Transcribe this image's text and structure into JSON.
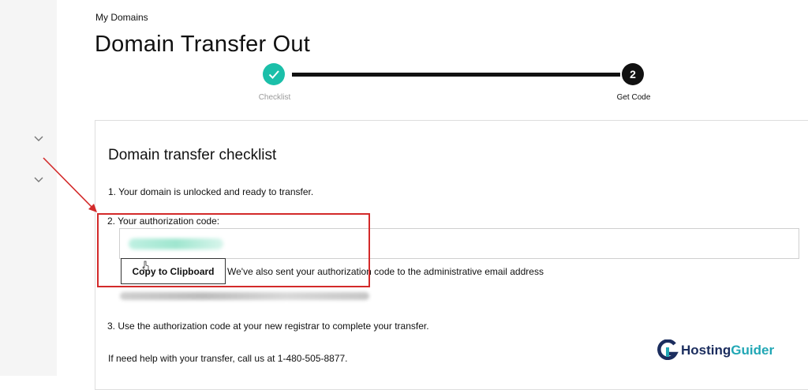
{
  "breadcrumb": "My Domains",
  "page_title": "Domain Transfer Out",
  "stepper": {
    "steps": [
      {
        "label": "Checklist",
        "state": "completed",
        "icon": "check-icon"
      },
      {
        "label": "Get Code",
        "number": "2",
        "state": "current"
      }
    ]
  },
  "checklist": {
    "title": "Domain transfer checklist",
    "item1": "1. Your domain is unlocked and ready to transfer.",
    "item2_label": "2. Your authorization code:",
    "copy_button": "Copy to Clipboard",
    "email_note": "We've also sent your authorization code to the administrative email address",
    "item3": "3. Use the authorization code at your new registrar to complete your transfer.",
    "help": "If need help with your transfer, call us at 1-480-505-8877."
  },
  "watermark": {
    "part1": "Hosting",
    "part2": "Guider"
  },
  "colors": {
    "accent_teal": "#1bbfa9",
    "highlight_red": "#d32a2a",
    "logo_navy": "#1b2d5e",
    "logo_teal": "#21a7b5"
  }
}
